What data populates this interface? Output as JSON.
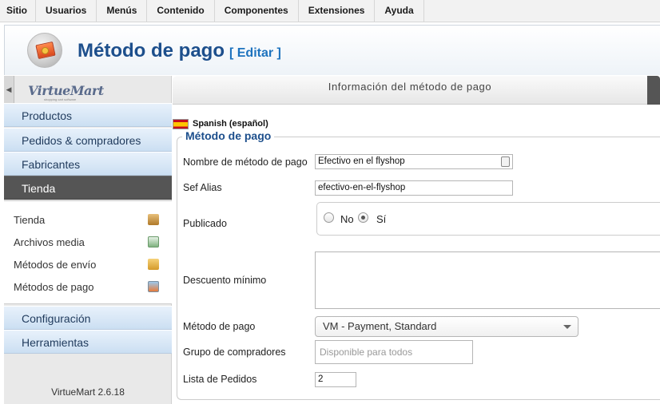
{
  "topmenu": [
    "Sitio",
    "Usuarios",
    "Menús",
    "Contenido",
    "Componentes",
    "Extensiones",
    "Ayuda"
  ],
  "header": {
    "title": "Método de pago",
    "edit": "[ Editar ]"
  },
  "sidebar": {
    "logo": "VirtueMart",
    "logo_tag": "shopping cart software",
    "sections_top": [
      "Productos",
      "Pedidos & compradores",
      "Fabricantes",
      "Tienda"
    ],
    "sub_items": [
      "Tienda",
      "Archivos media",
      "Métodos de envío",
      "Métodos de pago"
    ],
    "sections_bottom": [
      "Configuración",
      "Herramientas"
    ],
    "version": "VirtueMart 2.6.18"
  },
  "panel": {
    "title": "Información del método de pago"
  },
  "language": "Spanish (español)",
  "legend": "Método de pago",
  "form": {
    "name_label": "Nombre de método de pago",
    "name_value": "Efectivo en el flyshop",
    "alias_label": "Sef Alias",
    "alias_value": "efectivo-en-el-flyshop",
    "published_label": "Publicado",
    "published_no": "No",
    "published_yes": "Sí",
    "discount_label": "Descuento mínimo",
    "method_label": "Método de pago",
    "method_value": "VM - Payment, Standard",
    "group_label": "Grupo de compradores",
    "group_placeholder": "Disponible para todos",
    "order_label": "Lista de Pedidos",
    "order_value": "2"
  },
  "colors": {
    "accent": "#1d4f8c",
    "active_section": "#555555"
  }
}
